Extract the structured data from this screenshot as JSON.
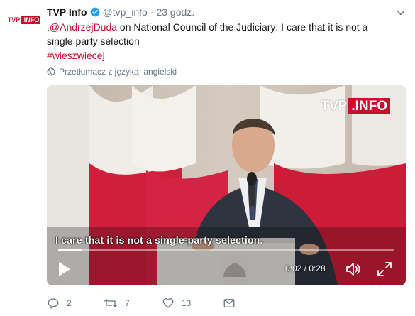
{
  "account": {
    "avatar_logo_tvp": "TVP",
    "avatar_logo_info": ".INFO",
    "name": "TVP Info",
    "handle": "@tvp_info",
    "separator": "·",
    "time": "23 godz."
  },
  "tweet": {
    "prefix": ".",
    "mention": "@AndrzejDuda",
    "text": " on National Council of the Judiciary: I care that it is not a single party selection",
    "hashtag": "#wieszwiecej"
  },
  "translate_label": "Przetłumacz z języka: angielski",
  "video": {
    "watermark_tvp": "TVP",
    "watermark_info": ".INFO",
    "subtitle": "I care that it is not a single-party selection.",
    "timecode": "0:02 / 0:28",
    "progress": 0.07
  },
  "actions": {
    "reply_count": "2",
    "retweet_count": "7",
    "like_count": "13"
  },
  "colors": {
    "accent": "#c8102e",
    "muted": "#657786",
    "verified": "#1da1f2"
  },
  "icons": [
    "verified-badge-icon",
    "caret-down-icon",
    "globe-icon",
    "play-icon",
    "volume-icon",
    "fullscreen-icon",
    "reply-icon",
    "retweet-icon",
    "like-icon",
    "direct-message-icon"
  ]
}
